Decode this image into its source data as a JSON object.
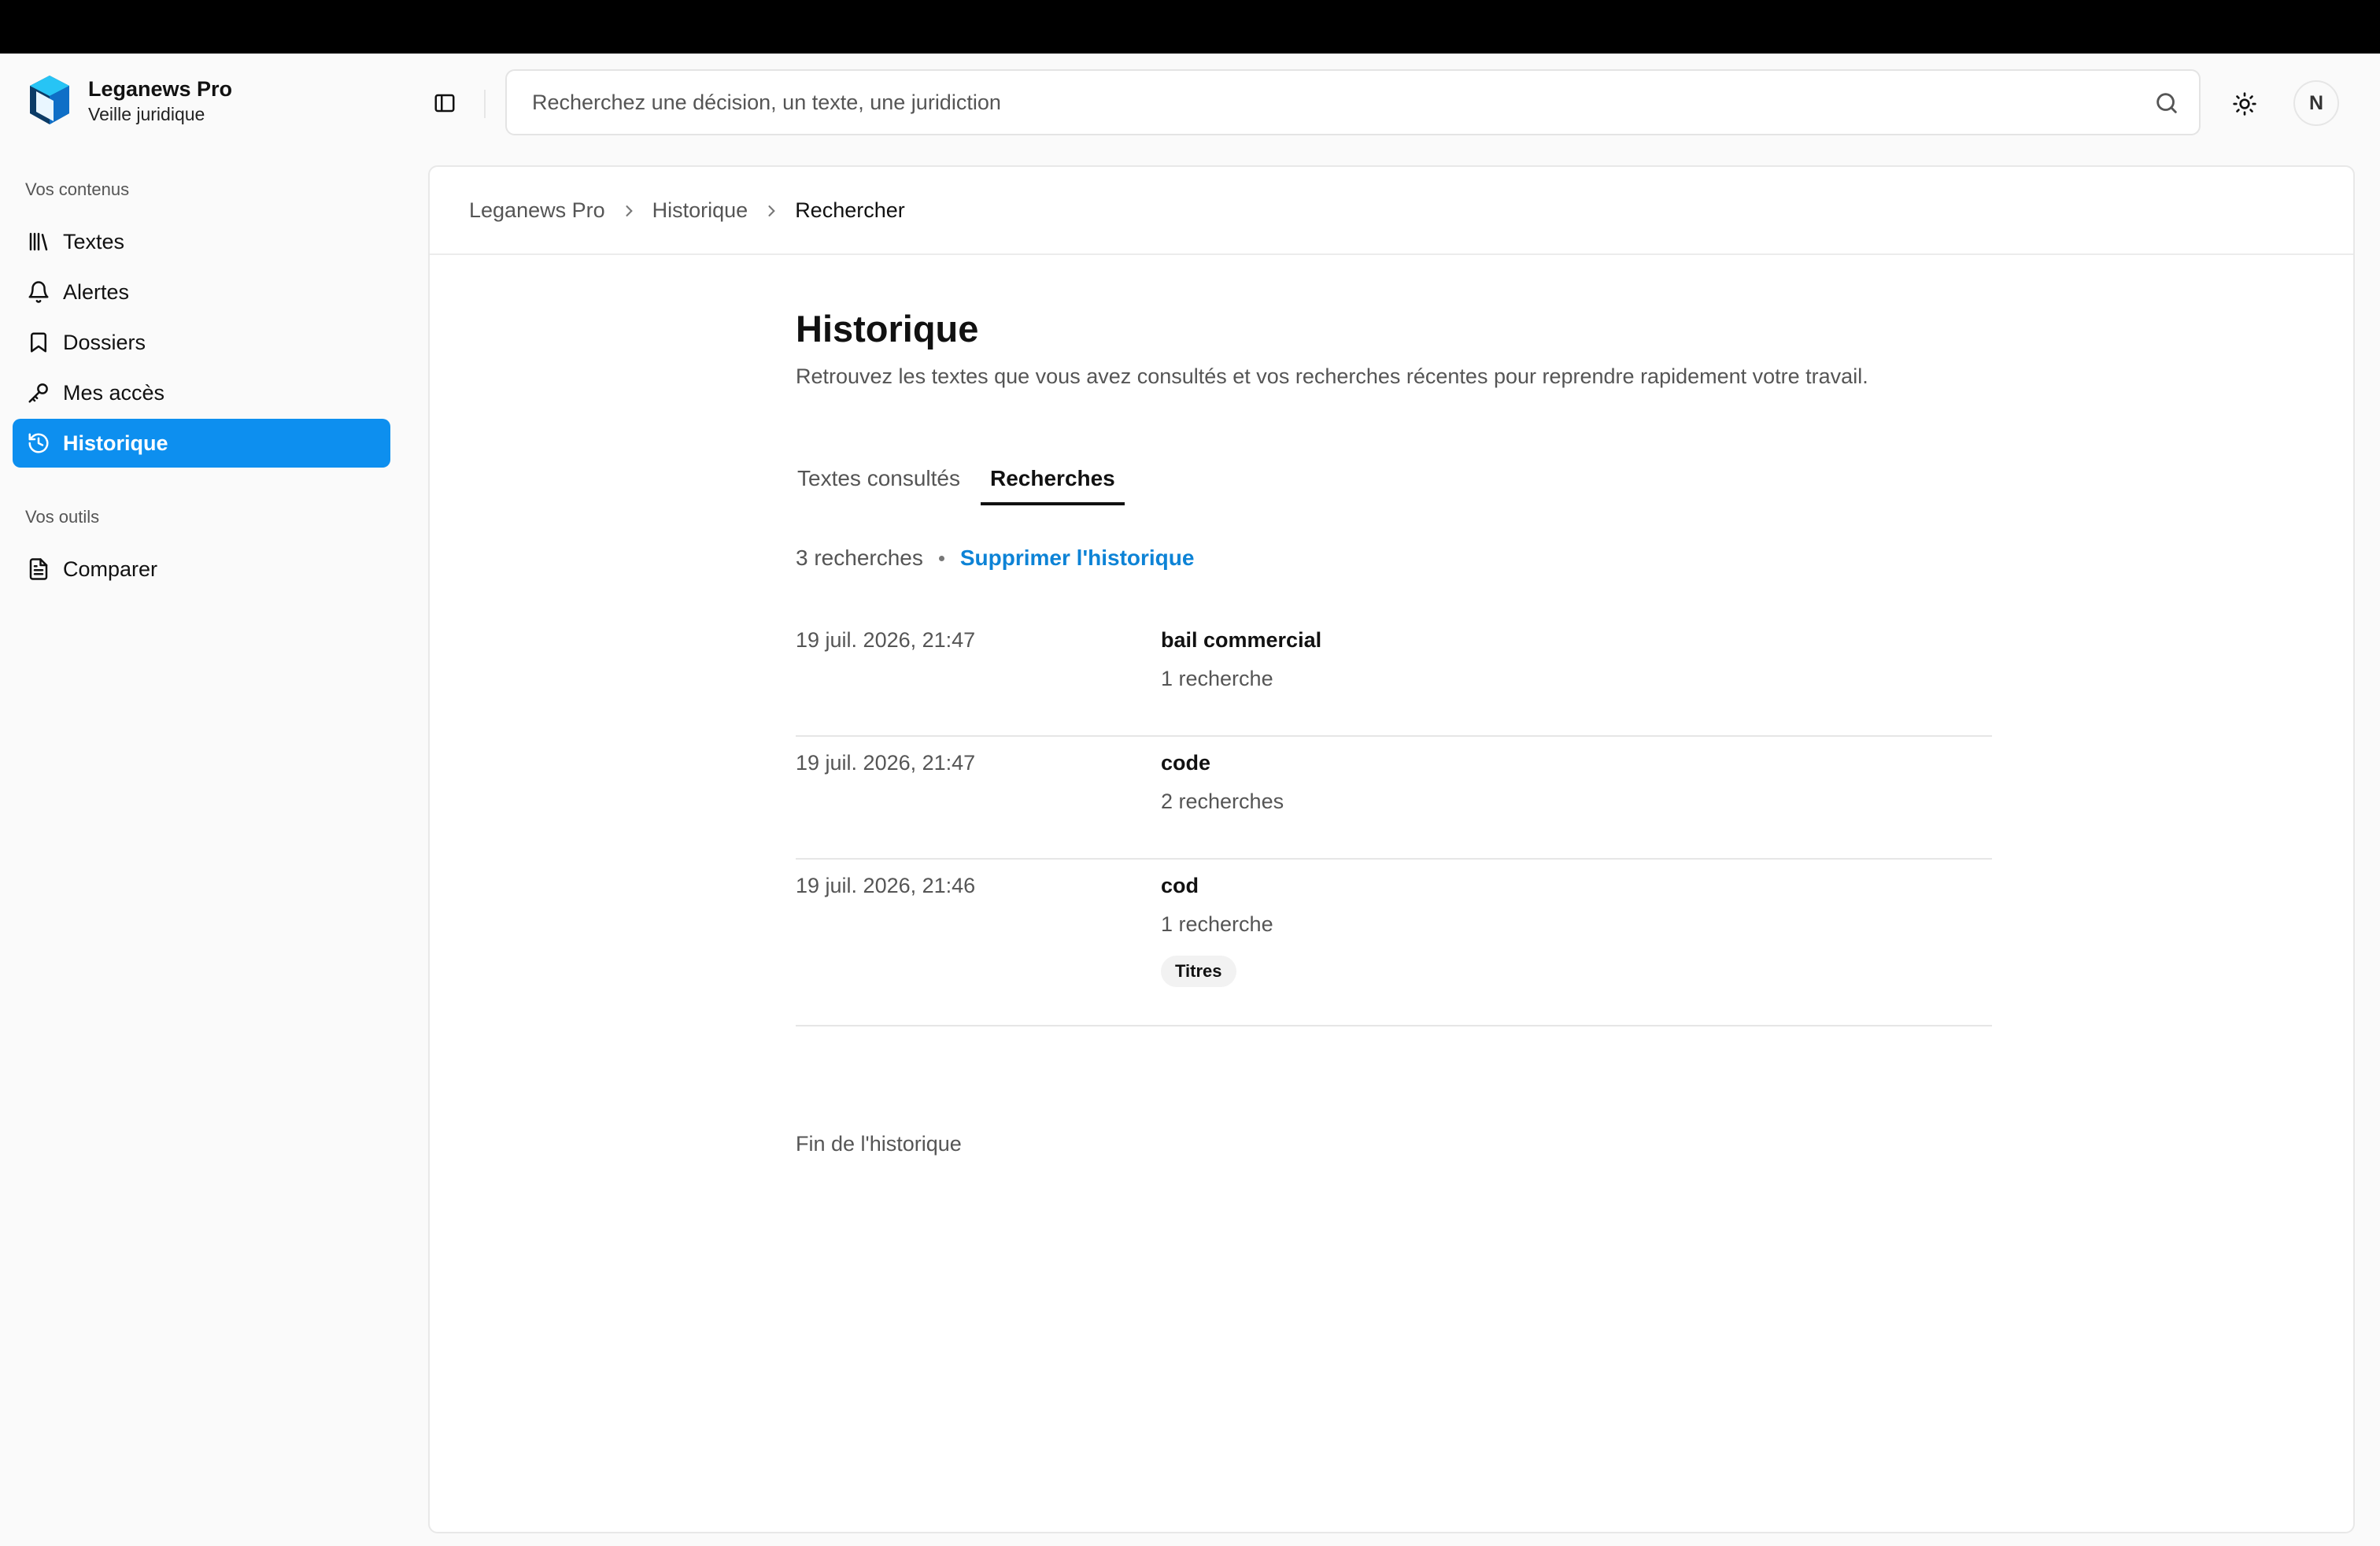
{
  "brand": {
    "title": "Leganews Pro",
    "subtitle": "Veille juridique"
  },
  "sidebar": {
    "section_contents": "Vos contenus",
    "items": [
      {
        "label": "Textes",
        "icon": "library-icon"
      },
      {
        "label": "Alertes",
        "icon": "bell-icon"
      },
      {
        "label": "Dossiers",
        "icon": "bookmark-icon"
      },
      {
        "label": "Mes accès",
        "icon": "key-icon"
      },
      {
        "label": "Historique",
        "icon": "history-icon",
        "active": true
      }
    ],
    "section_tools": "Vos outils",
    "tools": [
      {
        "label": "Comparer",
        "icon": "document-icon"
      }
    ]
  },
  "search": {
    "placeholder": "Recherchez une décision, un texte, une juridiction",
    "value": ""
  },
  "user": {
    "initial": "N"
  },
  "breadcrumb": [
    "Leganews Pro",
    "Historique",
    "Rechercher"
  ],
  "page": {
    "title": "Historique",
    "description": "Retrouvez les textes que vous avez consultés et vos recherches récentes pour reprendre rapidement votre travail."
  },
  "tabs": [
    {
      "label": "Textes consultés",
      "active": false
    },
    {
      "label": "Recherches",
      "active": true
    }
  ],
  "summary": {
    "count": "3 recherches",
    "clear_label": "Supprimer l'historique"
  },
  "history": [
    {
      "date": "19 juil. 2026, 21:47",
      "query": "bail commercial",
      "count": "1 recherche"
    },
    {
      "date": "19 juil. 2026, 21:47",
      "query": "code",
      "count": "2 recherches"
    },
    {
      "date": "19 juil. 2026, 21:46",
      "query": "cod",
      "count": "1 recherche",
      "tag": "Titres"
    }
  ],
  "end_note": "Fin de l'historique",
  "colors": {
    "accent": "#0d8fef",
    "link": "#0d83d6"
  }
}
